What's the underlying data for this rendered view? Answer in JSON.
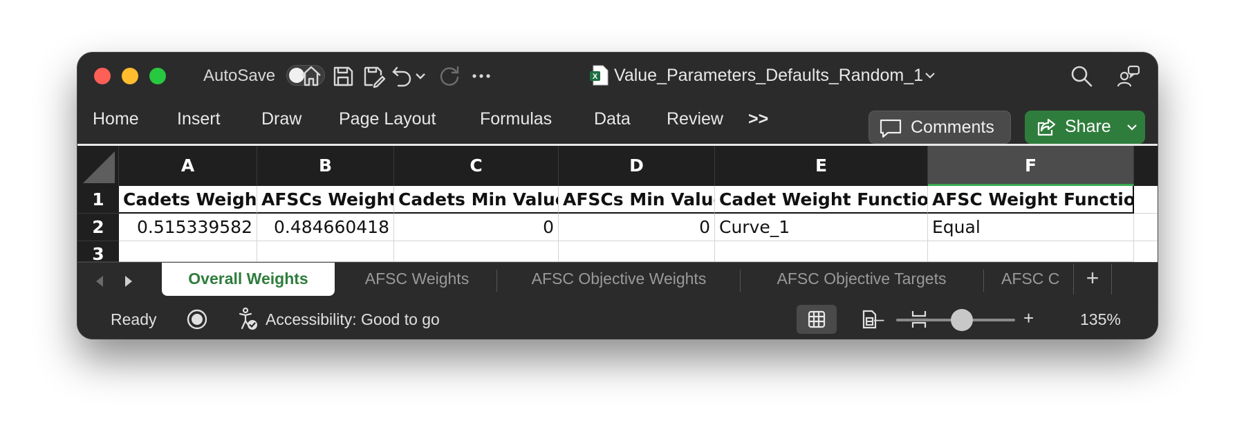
{
  "titlebar": {
    "autosave_label": "AutoSave",
    "autosave_on": false,
    "document_name": "Value_Parameters_Defaults_Random_1",
    "icons": [
      "home-icon",
      "save-icon",
      "save-as-icon",
      "undo-icon",
      "undo-dropdown-icon",
      "redo-icon",
      "more-icon",
      "excel-file-icon",
      "search-icon",
      "share-people-icon"
    ]
  },
  "ribbon": {
    "tabs": [
      "Home",
      "Insert",
      "Draw",
      "Page Layout",
      "Formulas",
      "Data",
      "Review"
    ],
    "overflow_label": ">>",
    "comments_label": "Comments",
    "share_label": "Share",
    "share_color": "#2f7d3c"
  },
  "sheet": {
    "columns": [
      "A",
      "B",
      "C",
      "D",
      "E",
      "F"
    ],
    "selected_column": "F",
    "rows": [
      "1",
      "2",
      "3"
    ],
    "header_row": [
      "Cadets Weight",
      "AFSCs Weight",
      "Cadets Min Value",
      "AFSCs Min Value",
      "Cadet Weight Function",
      "AFSC Weight Function"
    ],
    "data_row": [
      "0.515339582",
      "0.484660418",
      "0",
      "0",
      "Curve_1",
      "Equal"
    ]
  },
  "sheet_tabs": {
    "tabs": [
      "Overall Weights",
      "AFSC Weights",
      "AFSC Objective Weights",
      "AFSC Objective Targets",
      "AFSC C"
    ],
    "active": "Overall Weights",
    "add_label": "+"
  },
  "statusbar": {
    "ready": "Ready",
    "accessibility": "Accessibility: Good to go",
    "zoom_minus": "–",
    "zoom_plus": "+",
    "zoom_percent": "135%",
    "zoom_fraction": 0.55
  }
}
